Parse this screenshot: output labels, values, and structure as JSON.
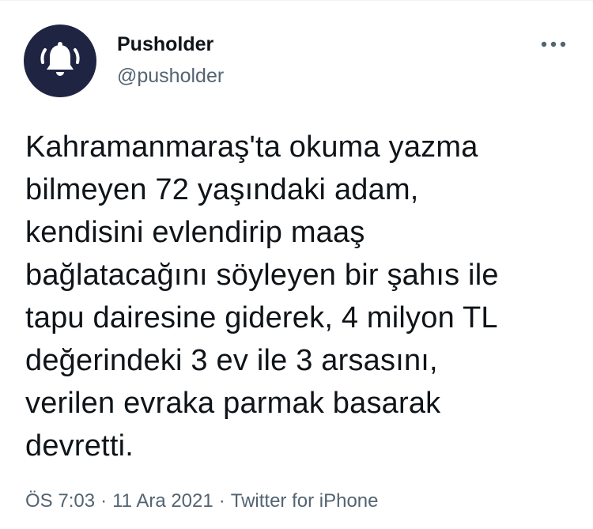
{
  "author": {
    "display_name": "Pusholder",
    "handle": "@pusholder",
    "avatar_icon": "bell-icon",
    "avatar_bg": "#1f2442"
  },
  "menu": {
    "icon": "more-options-icon"
  },
  "tweet": {
    "text": "Kahramanmaraş'ta okuma yazma\nbilmeyen 72 yaşındaki adam,\nkendisini evlendirip maaş\nbağlatacağını söyleyen bir şahıs ile\ntapu dairesine giderek, 4 milyon TL\ndeğerindeki 3 ev ile 3 arsasını,\nverilen evraka parmak basarak\ndevretti."
  },
  "meta": {
    "time": "ÖS 7:03",
    "separator": "·",
    "date": "11 Ara 2021",
    "source": "Twitter for iPhone"
  },
  "colors": {
    "text": "#0f1419",
    "secondary": "#536471"
  }
}
